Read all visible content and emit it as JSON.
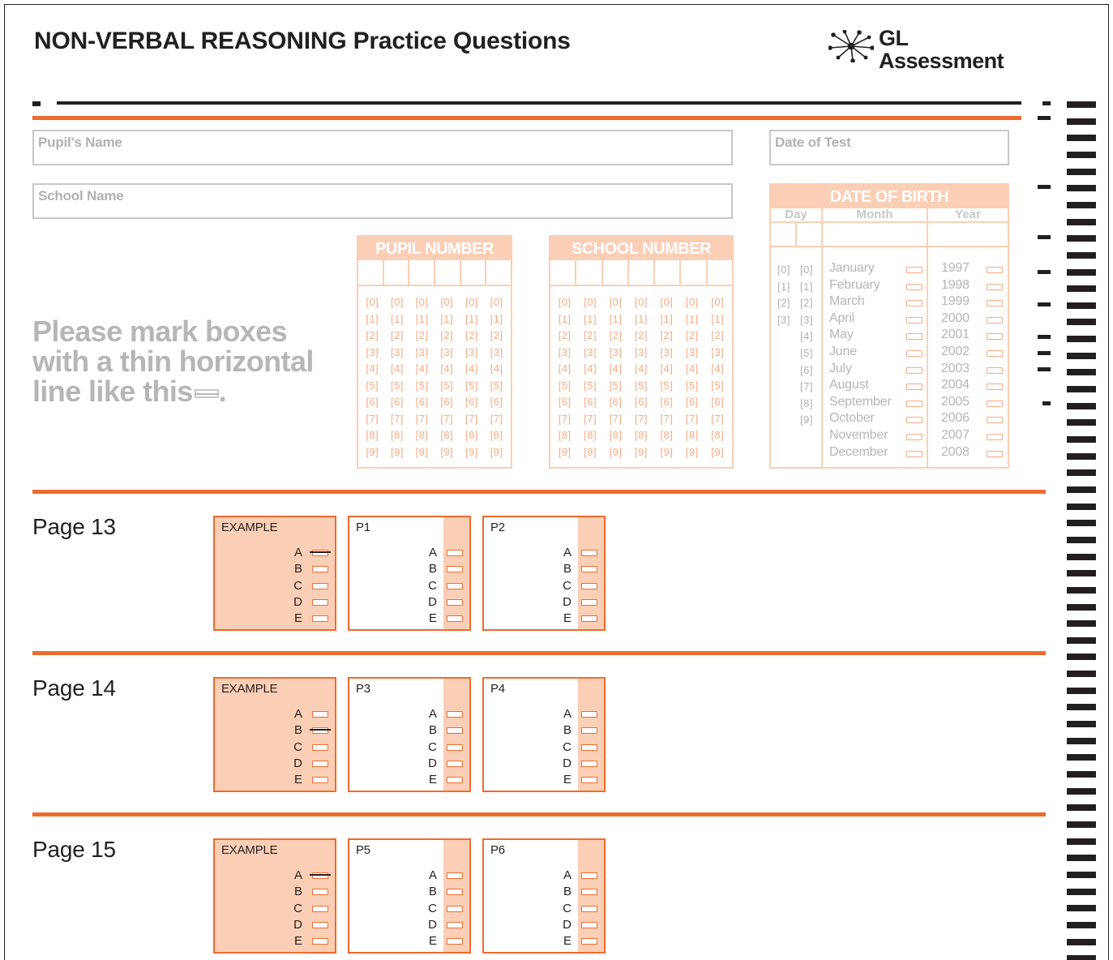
{
  "header": {
    "title": "NON-VERBAL REASONING Practice Questions",
    "logo_line1": "GL",
    "logo_line2": "Assessment",
    "logo_icon": "starburst-icon"
  },
  "fields": {
    "pupil_name_label": "Pupil's Name",
    "school_name_label": "School Name",
    "date_of_test_label": "Date of Test"
  },
  "instruction": {
    "line1": "Please mark boxes",
    "line2": "with a thin horizontal",
    "line3": "line like this",
    "line3_end": "."
  },
  "pupil_number": {
    "title": "PUPIL NUMBER",
    "digits": [
      "[0]",
      "[1]",
      "[2]",
      "[3]",
      "[4]",
      "[5]",
      "[6]",
      "[7]",
      "[8]",
      "[9]"
    ]
  },
  "school_number": {
    "title": "SCHOOL NUMBER",
    "digits": [
      "[0]",
      "[1]",
      "[2]",
      "[3]",
      "[4]",
      "[5]",
      "[6]",
      "[7]",
      "[8]",
      "[9]"
    ]
  },
  "dob": {
    "title": "DATE OF BIRTH",
    "day_label": "Day",
    "month_label": "Month",
    "year_label": "Year",
    "day_tens": [
      "[0]",
      "[1]",
      "[2]",
      "[3]"
    ],
    "day_units": [
      "[0]",
      "[1]",
      "[2]",
      "[3]",
      "[4]",
      "[5]",
      "[6]",
      "[7]",
      "[8]",
      "[9]"
    ],
    "months": [
      "January",
      "February",
      "March",
      "April",
      "May",
      "June",
      "July",
      "August",
      "September",
      "October",
      "November",
      "December"
    ],
    "years": [
      "1997",
      "1998",
      "1999",
      "2000",
      "2001",
      "2002",
      "2003",
      "2004",
      "2005",
      "2006",
      "2007",
      "2008"
    ]
  },
  "colors": {
    "accent": "#ee6b2f",
    "accent_light": "#fbcfb6",
    "ink": "#231f20",
    "grey": "#b5b6b8"
  },
  "sections": [
    {
      "label": "Page 13",
      "boxes": [
        {
          "title": "EXAMPLE",
          "example": true,
          "marked": "A"
        },
        {
          "title": "P1",
          "example": false,
          "marked": ""
        },
        {
          "title": "P2",
          "example": false,
          "marked": ""
        }
      ]
    },
    {
      "label": "Page 14",
      "boxes": [
        {
          "title": "EXAMPLE",
          "example": true,
          "marked": "B"
        },
        {
          "title": "P3",
          "example": false,
          "marked": ""
        },
        {
          "title": "P4",
          "example": false,
          "marked": ""
        }
      ]
    },
    {
      "label": "Page 15",
      "boxes": [
        {
          "title": "EXAMPLE",
          "example": true,
          "marked": "A"
        },
        {
          "title": "P5",
          "example": false,
          "marked": ""
        },
        {
          "title": "P6",
          "example": false,
          "marked": ""
        }
      ]
    }
  ],
  "options": [
    "A",
    "B",
    "C",
    "D",
    "E"
  ]
}
